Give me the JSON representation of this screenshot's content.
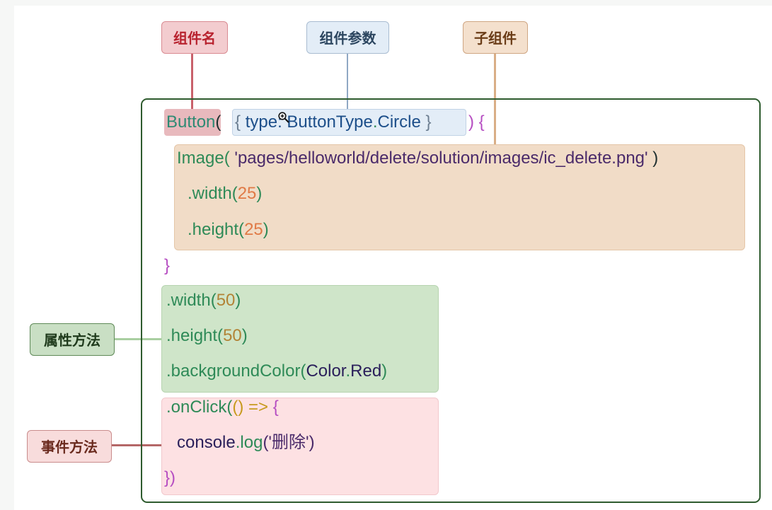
{
  "labels": {
    "component_name": "组件名",
    "component_params": "组件参数",
    "child_component": "子组件",
    "attribute_methods": "属性方法",
    "event_methods": "事件方法"
  },
  "code": {
    "button_name": "Button",
    "open_paren": "(",
    "brace_open": "{",
    "param_key": "type",
    "colon": ":",
    "param_enum": "ButtonType",
    "dot": ".",
    "param_value": "Circle",
    "brace_close": "}",
    "close_paren_brace": ") {",
    "image_call": "Image(",
    "image_path": "'pages/helloworld/delete/solution/images/ic_delete.png'",
    "image_close": ")",
    "child_width": ".width(",
    "child_width_val": "25",
    "child_height": ".height(",
    "child_height_val": "25",
    "close_paren": ")",
    "children_close": "}",
    "attr_width": ".width(",
    "attr_width_val": "50",
    "attr_height": ".height(",
    "attr_height_val": "50",
    "attr_bg": ".backgroundColor(",
    "attr_bg_enum": "Color",
    "attr_bg_value": "Red",
    "onclick": ".onClick(",
    "arrow_fn": "() =>",
    "arrow_brace": "{",
    "console": "console",
    "log": "log",
    "log_arg": "('删除')",
    "event_close": "})"
  },
  "colors": {
    "component_name": "#b8232f",
    "component_params": "#2c4660",
    "child_component": "#6b3d18",
    "attribute_methods": "#1f3a1c",
    "event_methods": "#6a2a1e",
    "frame": "#2e5b2e"
  },
  "icons": {
    "cursor": "zoom-in-icon"
  }
}
